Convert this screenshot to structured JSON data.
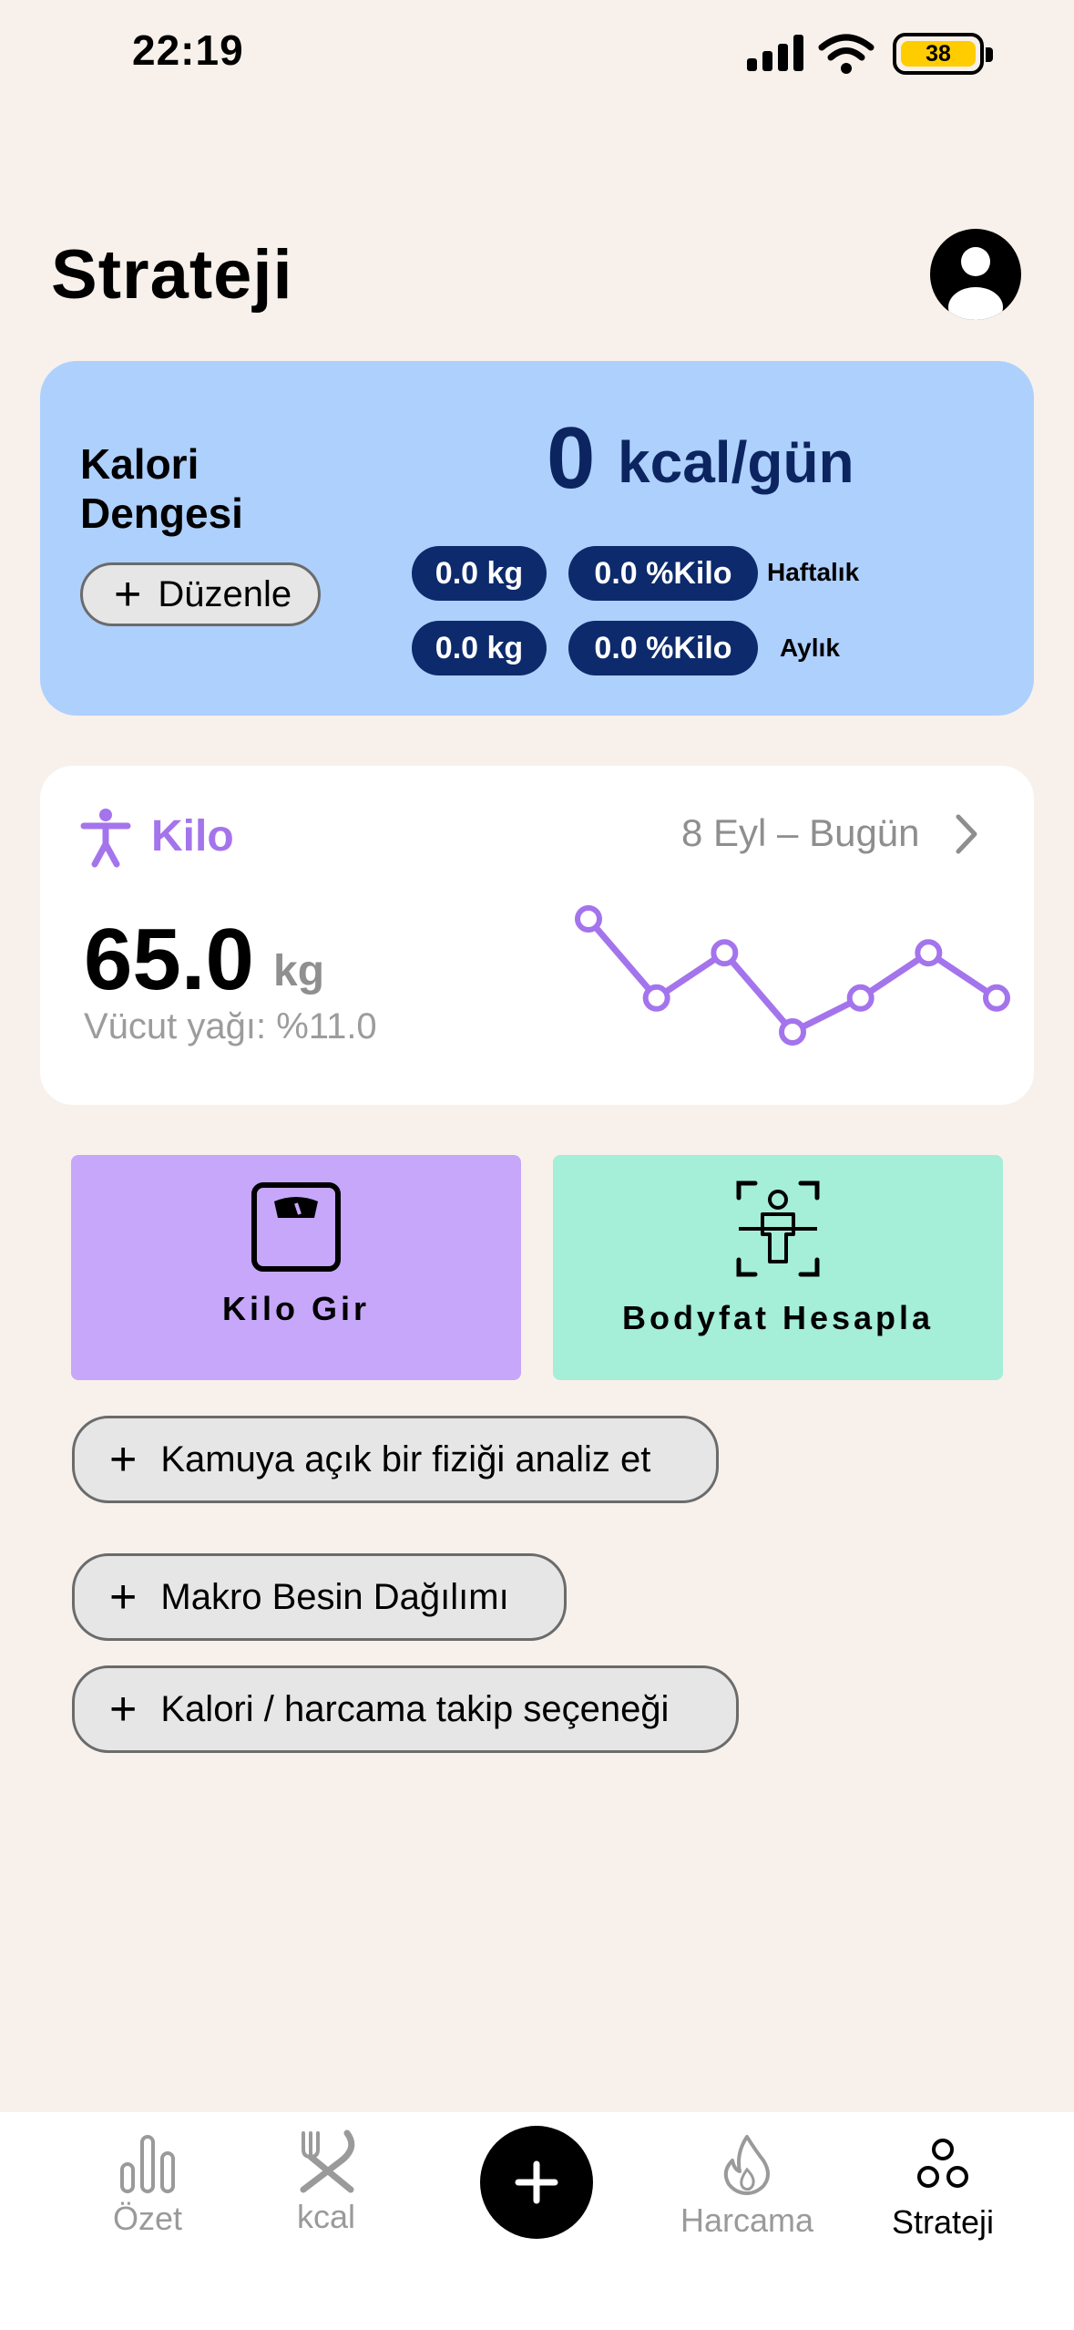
{
  "status_bar": {
    "time": "22:19",
    "battery": "38"
  },
  "page_title": "Strateji",
  "kalori_card": {
    "label": "Kalori Dengesi",
    "edit_label": "Düzenle",
    "value": "0",
    "unit": "kcal/gün",
    "weekly": {
      "kg": "0.0 kg",
      "pct": "0.0 %Kilo",
      "label": "Haftalık"
    },
    "monthly": {
      "kg": "0.0 kg",
      "pct": "0.0 %Kilo",
      "label": "Aylık"
    }
  },
  "weight_card": {
    "title": "Kilo",
    "range": "8 Eyl – Bugün",
    "value": "65.0",
    "unit": "kg",
    "body_fat": "Vücut yağı: %11.0"
  },
  "chart_data": {
    "type": "line",
    "x": [
      1,
      2,
      3,
      4,
      5,
      6,
      7
    ],
    "values": [
      65.6,
      64.9,
      65.3,
      64.6,
      64.9,
      65.3,
      64.9
    ],
    "color": "#a474ec"
  },
  "actions": {
    "kilo_gir": "Kilo Gir",
    "bodyfat": "Bodyfat Hesapla",
    "analyze": "Kamuya açık bir fiziği analiz et",
    "macro": "Makro Besin Dağılımı",
    "tracking": "Kalori / harcama takip seçeneği"
  },
  "nav": {
    "ozet": "Özet",
    "kcal": "kcal",
    "harcama": "Harcama",
    "strateji": "Strateji"
  },
  "colors": {
    "background": "#f8f1eb",
    "kalori_card": "#aed0fd",
    "pill": "#0d2a6c",
    "accent_purple": "#a474ec",
    "tile_purple": "#c7a7fa",
    "tile_green": "#a5eed8"
  }
}
